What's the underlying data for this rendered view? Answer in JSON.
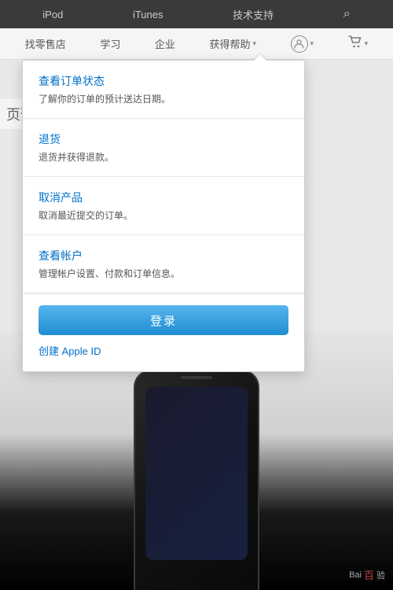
{
  "topNav": {
    "items": [
      {
        "id": "ipod",
        "label": "iPod"
      },
      {
        "id": "itunes",
        "label": "iTunes"
      },
      {
        "id": "tech-support",
        "label": "技术支持"
      }
    ],
    "searchIcon": "🔍"
  },
  "secNav": {
    "items": [
      {
        "id": "find-store",
        "label": "找零售店"
      },
      {
        "id": "learn",
        "label": "学习"
      },
      {
        "id": "enterprise",
        "label": "企业"
      }
    ],
    "helpItem": {
      "label": "获得帮助"
    },
    "accountIcon": "👤",
    "cartIcon": "🛒"
  },
  "dropdown": {
    "arrowLabel": "▲",
    "items": [
      {
        "id": "order-status",
        "title": "查看订单状态",
        "desc": "了解你的订单的预计送达日期。"
      },
      {
        "id": "return",
        "title": "退货",
        "desc": "退货并获得退款。"
      },
      {
        "id": "cancel-product",
        "title": "取消产品",
        "desc": "取消最近提交的订单。"
      },
      {
        "id": "view-account",
        "title": "查看帐户",
        "desc": "管理帐户设置、付款和订单信息。"
      }
    ],
    "loginButton": "登录",
    "createAppleId": "创建 Apple ID"
  },
  "page": {
    "previewText": "页预",
    "baiduText": "Bai",
    "baiduSuffix": "验"
  }
}
